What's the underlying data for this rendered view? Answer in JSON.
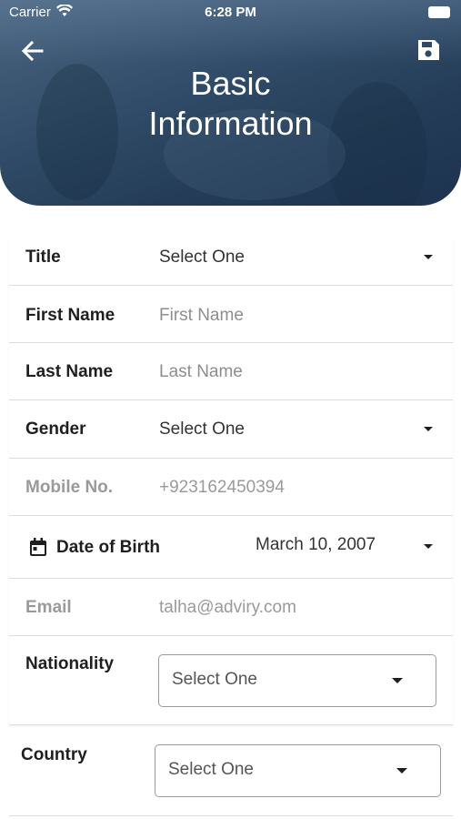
{
  "status_bar": {
    "carrier": "Carrier",
    "time": "6:28 PM"
  },
  "header": {
    "title_line1": "Basic",
    "title_line2": "Information",
    "back_icon": "arrow-left-icon",
    "save_icon": "floppy-disk-icon",
    "colors": {
      "overlay": "#2f4a66",
      "title": "#ffffff"
    }
  },
  "form": {
    "title": {
      "label": "Title",
      "value": "Select One"
    },
    "first_name": {
      "label": "First Name",
      "placeholder": "First Name"
    },
    "last_name": {
      "label": "Last Name",
      "placeholder": "Last Name"
    },
    "gender": {
      "label": "Gender",
      "value": "Select One"
    },
    "mobile": {
      "label": "Mobile No.",
      "value": "+923162450394"
    },
    "dob": {
      "label": "Date of Birth",
      "value": "March 10, 2007",
      "icon": "calendar-icon"
    },
    "email": {
      "label": "Email",
      "value": "talha@adviry.com"
    },
    "nationality": {
      "label": "Nationality",
      "value": "Select One"
    },
    "country": {
      "label": "Country",
      "value": "Select One"
    }
  }
}
